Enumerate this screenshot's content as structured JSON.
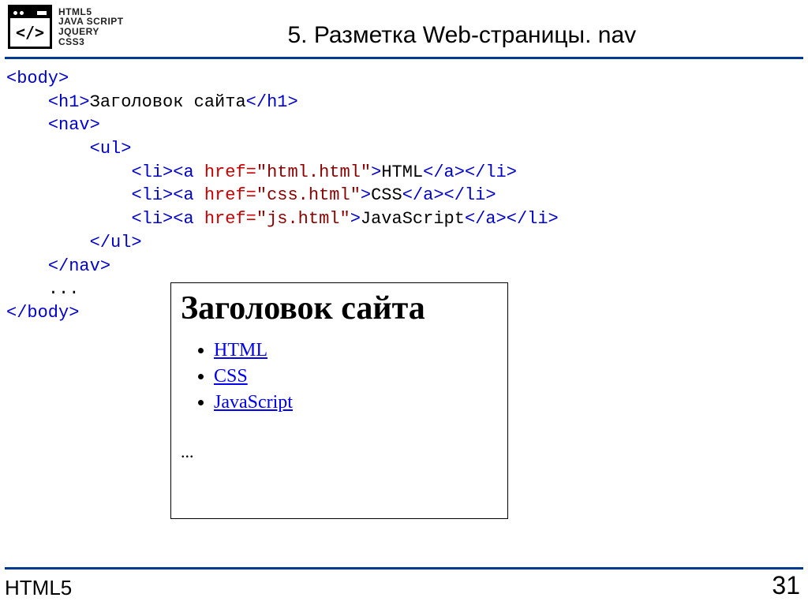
{
  "header": {
    "logo_glyph": "</>",
    "stack": [
      "HTML5",
      "JAVA SCRIPT",
      "JQUERY",
      "CSS3"
    ],
    "title": "5. Разметка Web-страницы. nav"
  },
  "code": {
    "body_open": "<body>",
    "h1_open": "<h1>",
    "h1_text": "Заголовок сайта",
    "h1_close": "</h1>",
    "nav_open": "<nav>",
    "ul_open": "<ul>",
    "li_open": "<li>",
    "li_close": "</li>",
    "a_open_start": "<a",
    "a_close_tag": "</a>",
    "href_attr": " href=",
    "q1": "\"html.html\"",
    "q2": "\"css.html\"",
    "q3": "\"js.html\"",
    "gt": ">",
    "txt1": "HTML",
    "txt2": "CSS",
    "txt3": "JavaScript",
    "ul_close": "</ul>",
    "nav_close": "</nav>",
    "ellipsis": "...",
    "body_close": "</body>"
  },
  "preview": {
    "heading": "Заголовок сайта",
    "items": [
      "HTML",
      "CSS",
      "JavaScript"
    ],
    "dots": "..."
  },
  "footer": {
    "left": "HTML5",
    "right": "31"
  }
}
